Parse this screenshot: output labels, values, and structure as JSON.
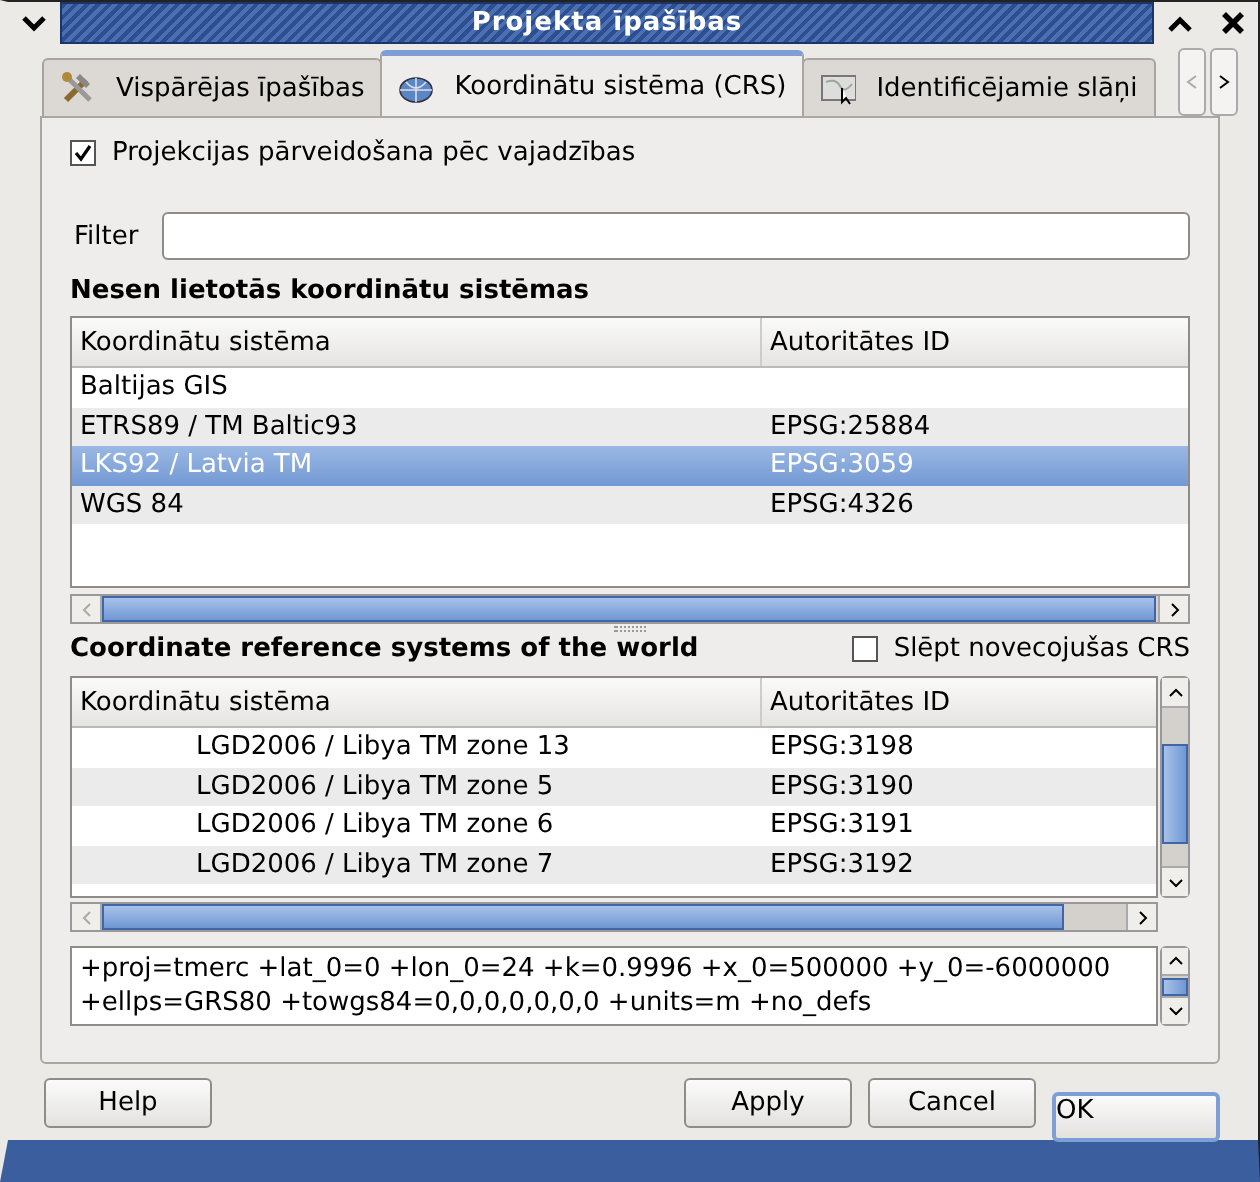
{
  "window": {
    "title": "Projekta īpašības"
  },
  "tabs": [
    {
      "label": "Vispārējas īpašības",
      "kind": "tools",
      "selected": false
    },
    {
      "label": "Koordinātu sistēma (CRS)",
      "kind": "globe",
      "selected": true
    },
    {
      "label": "Identificējamie slāņi",
      "kind": "map",
      "selected": false
    }
  ],
  "reproject": {
    "label": "Projekcijas pārveidošana pēc vajadzības",
    "checked": true
  },
  "filter": {
    "label": "Filter"
  },
  "recent": {
    "heading": "Nesen lietotās koordinātu sistēmas",
    "columns": [
      "Koordinātu sistēma",
      "Autoritātes ID"
    ],
    "rows": [
      {
        "cells": [
          "Baltijas GIS",
          ""
        ],
        "selected": false
      },
      {
        "cells": [
          "ETRS89 / TM Baltic93",
          "EPSG:25884"
        ],
        "selected": false
      },
      {
        "cells": [
          "LKS92 / Latvia TM",
          "EPSG:3059"
        ],
        "selected": true
      },
      {
        "cells": [
          "WGS 84",
          "EPSG:4326"
        ],
        "selected": false
      }
    ]
  },
  "world": {
    "heading": "Coordinate reference systems of the world",
    "hide_deprecated": {
      "label": "Slēpt novecojušas CRS",
      "checked": false
    },
    "columns": [
      "Koordinātu sistēma",
      "Autoritātes ID"
    ],
    "rows": [
      {
        "cells": [
          "LGD2006 / Libya TM zone 13",
          "EPSG:3198"
        ],
        "selected": false
      },
      {
        "cells": [
          "LGD2006 / Libya TM zone 5",
          "EPSG:3190"
        ],
        "selected": false
      },
      {
        "cells": [
          "LGD2006 / Libya TM zone 6",
          "EPSG:3191"
        ],
        "selected": false
      },
      {
        "cells": [
          "LGD2006 / Libya TM zone 7",
          "EPSG:3192"
        ],
        "selected": false
      }
    ]
  },
  "definition": [
    "+proj=tmerc +lat_0=0 +lon_0=24 +k=0.9996 +x_0=500000 +y_0=-6000000",
    "+ellps=GRS80 +towgs84=0,0,0,0,0,0,0 +units=m +no_defs"
  ],
  "buttons": [
    {
      "label": "Help",
      "kind": "left",
      "default": false
    },
    {
      "label": "Apply",
      "kind": "right",
      "default": false
    },
    {
      "label": "Cancel",
      "kind": "right",
      "default": false
    },
    {
      "label": "OK",
      "kind": "right",
      "default": true
    }
  ]
}
